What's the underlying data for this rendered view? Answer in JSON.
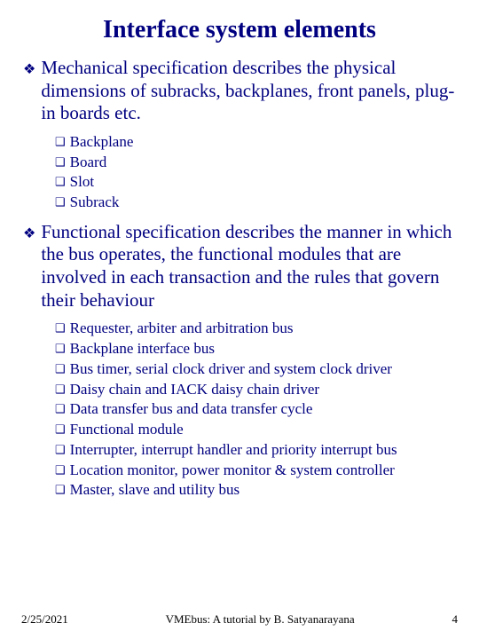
{
  "title": "Interface system elements",
  "bullets": [
    {
      "text": "Mechanical specification describes the physical dimensions of subracks, backplanes, front panels, plug-in boards etc.",
      "sub": [
        "Backplane",
        "Board",
        "Slot",
        "Subrack"
      ]
    },
    {
      "text": "Functional specification describes the manner in which the bus operates, the functional modules that are involved in each transaction and the rules that govern their behaviour",
      "sub": [
        "Requester, arbiter and arbitration bus",
        "Backplane interface bus",
        "Bus timer, serial clock driver and system clock driver",
        "Daisy chain and IACK daisy chain driver",
        "Data transfer bus and data transfer cycle",
        " Functional module",
        "Interrupter, interrupt handler and priority interrupt bus",
        "Location monitor, power monitor & system controller",
        "Master, slave and utility bus"
      ]
    }
  ],
  "footer": {
    "date": "2/25/2021",
    "center": "VMEbus: A tutorial by B. Satyanarayana",
    "page": "4"
  }
}
